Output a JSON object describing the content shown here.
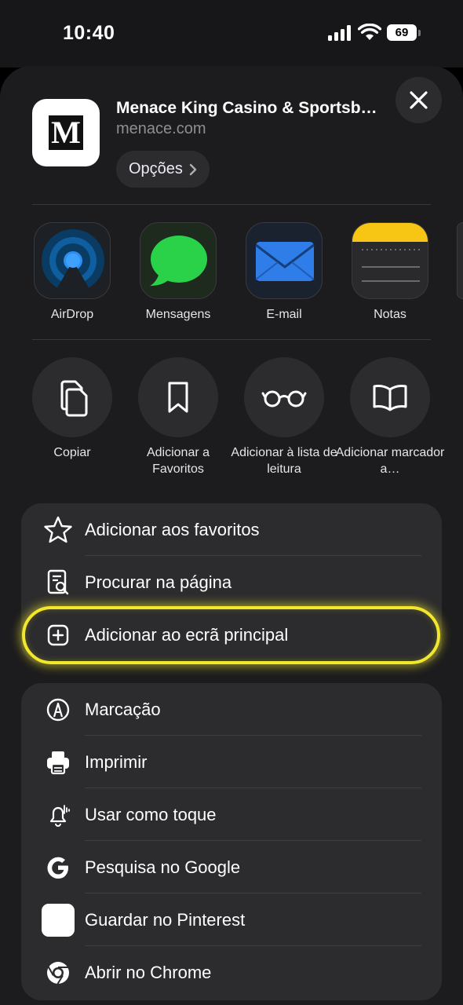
{
  "status_bar": {
    "time": "10:40",
    "battery": "69"
  },
  "site": {
    "title": "Menace King Casino & Sportsbook",
    "url": "menace.com",
    "logo_letter": "M",
    "options_label": "Opções"
  },
  "apps": [
    {
      "label": "AirDrop",
      "icon": "airdrop-icon"
    },
    {
      "label": "Mensagens",
      "icon": "messages-icon"
    },
    {
      "label": "E-mail",
      "icon": "mail-icon"
    },
    {
      "label": "Notas",
      "icon": "notes-icon"
    }
  ],
  "actions": [
    {
      "label": "Copiar",
      "icon": "copy-icon"
    },
    {
      "label": "Adicionar a Favoritos",
      "icon": "bookmark-icon"
    },
    {
      "label": "Adicionar à lista de leitura",
      "icon": "glasses-icon"
    },
    {
      "label": "Adicionar marcador a…",
      "icon": "book-icon"
    }
  ],
  "menu_group_1": [
    {
      "label": "Adicionar aos favoritos",
      "icon": "star-icon"
    },
    {
      "label": "Procurar na página",
      "icon": "find-in-page-icon"
    },
    {
      "label": "Adicionar ao ecrã principal",
      "icon": "add-square-icon",
      "highlighted": true
    }
  ],
  "menu_group_2": [
    {
      "label": "Marcação",
      "icon": "markup-icon"
    },
    {
      "label": "Imprimir",
      "icon": "printer-icon"
    },
    {
      "label": "Usar como toque",
      "icon": "bell-icon"
    },
    {
      "label": "Pesquisa no Google",
      "icon": "google-icon"
    },
    {
      "label": "Guardar no Pinterest",
      "icon": "pinterest-icon"
    },
    {
      "label": "Abrir no Chrome",
      "icon": "chrome-icon"
    }
  ],
  "colors": {
    "sheet": "#1c1c1e",
    "group": "#2c2c2e",
    "highlight": "#f2e82b"
  }
}
